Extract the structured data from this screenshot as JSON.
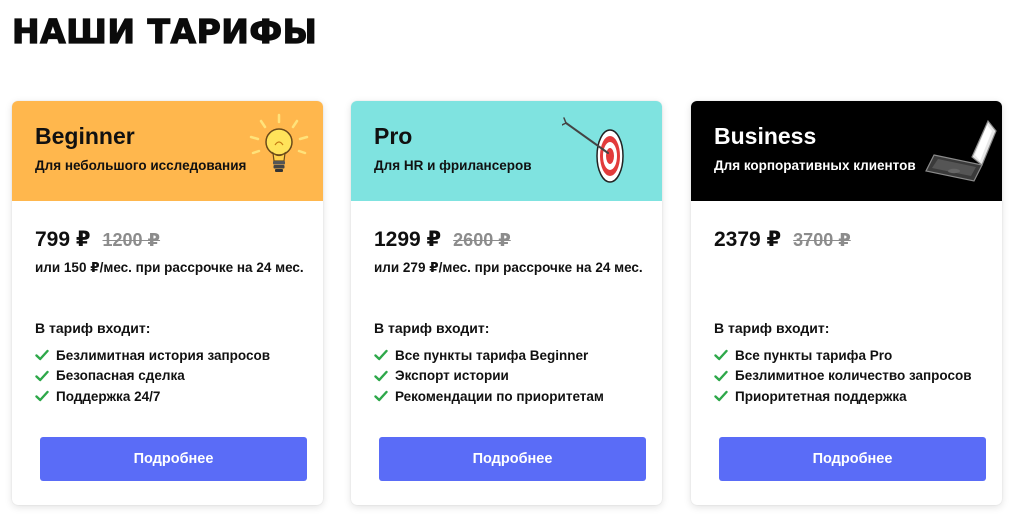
{
  "page": {
    "title": "НАШИ ТАРИФЫ"
  },
  "colors": {
    "button": "#5a6cf7",
    "check": "#2ea84a",
    "beginner_header": "#ffb74d",
    "pro_header": "#7fe3e0",
    "business_header": "#000000"
  },
  "plans": [
    {
      "name": "Beginner",
      "subtitle": "Для небольшого исследования",
      "icon": "lightbulb-icon",
      "price": "799 ₽",
      "old_price": "1200 ₽",
      "installment": "или 150 ₽/мес. при рассрочке на 24 мес.",
      "includes_title": "В тариф входит:",
      "features": [
        "Безлимитная история запросов",
        "Безопасная сделка",
        "Поддержка 24/7"
      ],
      "button": "Подробнее"
    },
    {
      "name": "Pro",
      "subtitle": "Для HR и фрилансеров",
      "icon": "target-icon",
      "price": "1299 ₽",
      "old_price": "2600 ₽",
      "installment": "или 279 ₽/мес. при рассрочке на 24 мес.",
      "includes_title": "В тариф входит:",
      "features": [
        "Все пункты тарифа Beginner",
        "Экспорт истории",
        "Рекомендации по приоритетам"
      ],
      "button": "Подробнее"
    },
    {
      "name": "Business",
      "subtitle": "Для корпоративных клиентов",
      "icon": "laptop-icon",
      "price": "2379 ₽",
      "old_price": "3700 ₽",
      "installment": "",
      "includes_title": "В тариф входит:",
      "features": [
        "Все пункты тарифа Pro",
        "Безлимитное количество запросов",
        "Приоритетная поддержка"
      ],
      "button": "Подробнее"
    }
  ]
}
